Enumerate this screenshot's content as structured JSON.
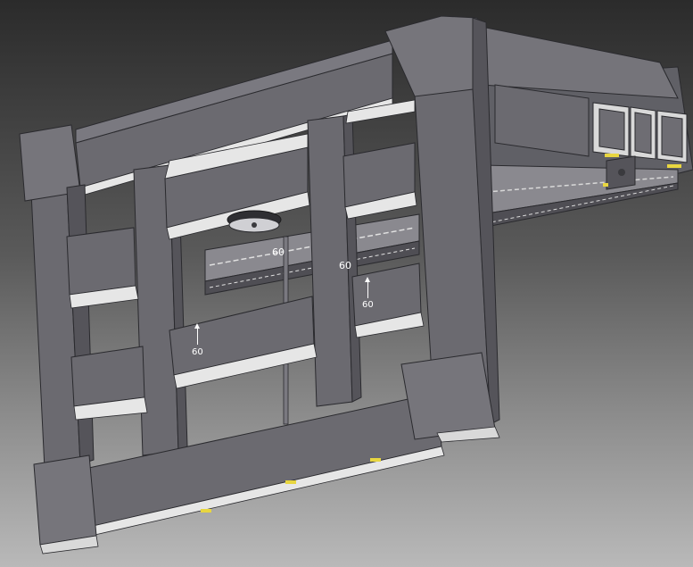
{
  "viewport": {
    "scene": "cad-3d-model-view",
    "background_top": "#2b2b2b",
    "background_bottom": "#b9b9b9",
    "part_fill": "#6b6a70",
    "part_face_light": "#7a7980",
    "part_face_dark": "#55545a",
    "part_edge": "#2a2a2e",
    "inner_face": "#e6e6e6",
    "highlight_yellow": "#e8d640"
  },
  "annotations": {
    "dimension_left": "60",
    "dimension_right": "60",
    "weld_symbol_left": "60",
    "weld_symbol_right": "60"
  }
}
